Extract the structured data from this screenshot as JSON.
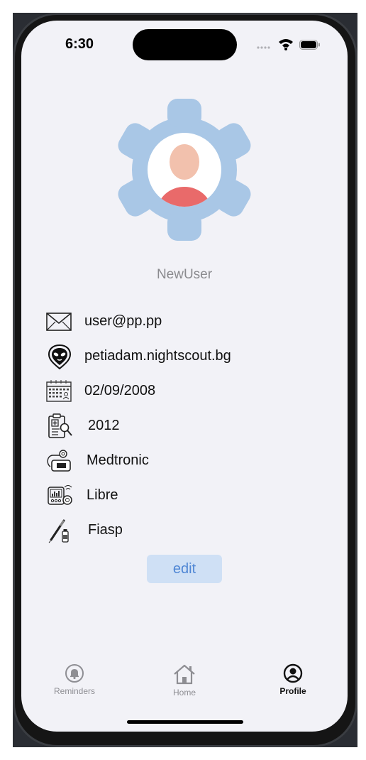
{
  "status_bar": {
    "time": "6:30"
  },
  "profile": {
    "username": "NewUser",
    "details": [
      {
        "icon": "envelope-icon",
        "value": "user@pp.pp"
      },
      {
        "icon": "nightscout-icon",
        "value": "petiadam.nightscout.bg"
      },
      {
        "icon": "calendar-icon",
        "value": "02/09/2008"
      },
      {
        "icon": "diagnosis-report-icon",
        "value": "2012"
      },
      {
        "icon": "insulin-pump-icon",
        "value": "Medtronic"
      },
      {
        "icon": "glucose-sensor-icon",
        "value": "Libre"
      },
      {
        "icon": "insulin-pen-icon",
        "value": "Fiasp"
      }
    ],
    "edit_label": "edit"
  },
  "tabbar": {
    "tabs": [
      {
        "icon": "bell-icon",
        "label": "Reminders",
        "active": false
      },
      {
        "icon": "home-icon",
        "label": "Home",
        "active": false
      },
      {
        "icon": "profile-icon",
        "label": "Profile",
        "active": true
      }
    ]
  },
  "colors": {
    "screen_bg": "#f2f2f7",
    "gear": "#a9c7e6",
    "avatar_skin": "#f2c1ad",
    "avatar_shirt": "#e96a6a",
    "edit_bg": "#cfe0f5",
    "edit_text": "#4f86d4"
  }
}
